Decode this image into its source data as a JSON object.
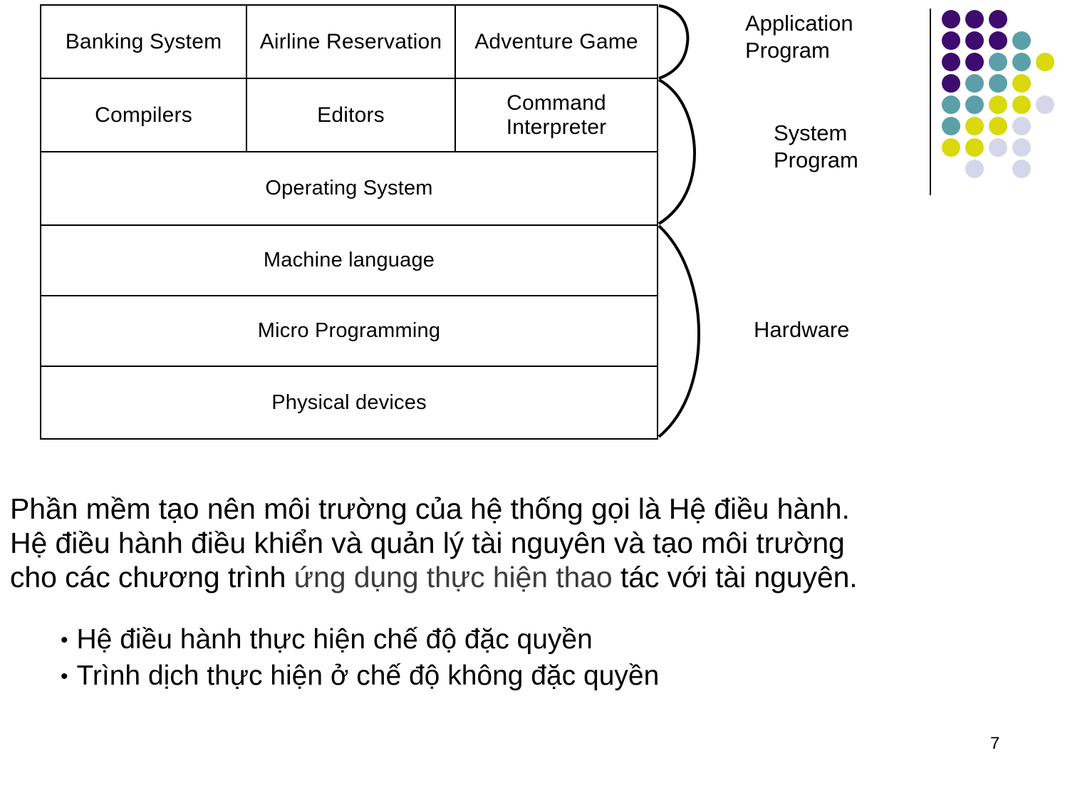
{
  "slide": {
    "page_number": "7"
  },
  "diagram": {
    "rows": [
      {
        "name": "application-row",
        "cells": [
          "Banking\nSystem",
          "Airline\nReservation",
          "Adventure\nGame"
        ]
      },
      {
        "name": "system-program-row",
        "cells": [
          "Compilers",
          "Editors",
          "Command\nInterpreter"
        ]
      },
      {
        "name": "operating-system-row",
        "cells": [
          "Operating System"
        ]
      },
      {
        "name": "machine-language-row",
        "cells": [
          "Machine language"
        ]
      },
      {
        "name": "micro-programming-row",
        "cells": [
          "Micro Programming"
        ]
      },
      {
        "name": "physical-devices-row",
        "cells": [
          "Physical devices"
        ]
      }
    ],
    "side_labels": {
      "application": "Application\nProgram",
      "system": "System\nProgram",
      "hardware": "Hardware"
    }
  },
  "logo": {
    "colors": {
      "purple": "#3d0c6e",
      "teal": "#5ba0a8",
      "yellow": "#d9d90d",
      "lavender": "#d6d6ea"
    },
    "grid": [
      [
        "purple",
        "purple",
        "purple",
        null,
        null
      ],
      [
        "purple",
        "purple",
        "purple",
        "teal",
        null
      ],
      [
        "purple",
        "purple",
        "teal",
        "teal",
        "yellow"
      ],
      [
        "purple",
        "teal",
        "teal",
        "yellow",
        null
      ],
      [
        "teal",
        "teal",
        "yellow",
        "yellow",
        "lavender"
      ],
      [
        "teal",
        "yellow",
        "yellow",
        "lavender",
        null
      ],
      [
        "yellow",
        "yellow",
        "lavender",
        "lavender",
        null
      ],
      [
        null,
        "lavender",
        null,
        "lavender",
        null
      ]
    ]
  },
  "body": {
    "line1": "Phần mềm tạo nên môi trường của hệ thống gọi là Hệ điều hành.",
    "line2": "Hệ điều hành điều khiển và quản lý tài nguyên và tạo môi trường",
    "line3_a": "cho các chương trình ",
    "line3_b": "ứng dụng thực hiện thao",
    "line3_c": " tác với tài nguyên."
  },
  "bullets": {
    "marker": "•",
    "items": [
      "Hệ điều hành thực hiện chế độ đặc quyền",
      "Trình dịch thực hiện ở chế độ không đặc quyền"
    ]
  }
}
